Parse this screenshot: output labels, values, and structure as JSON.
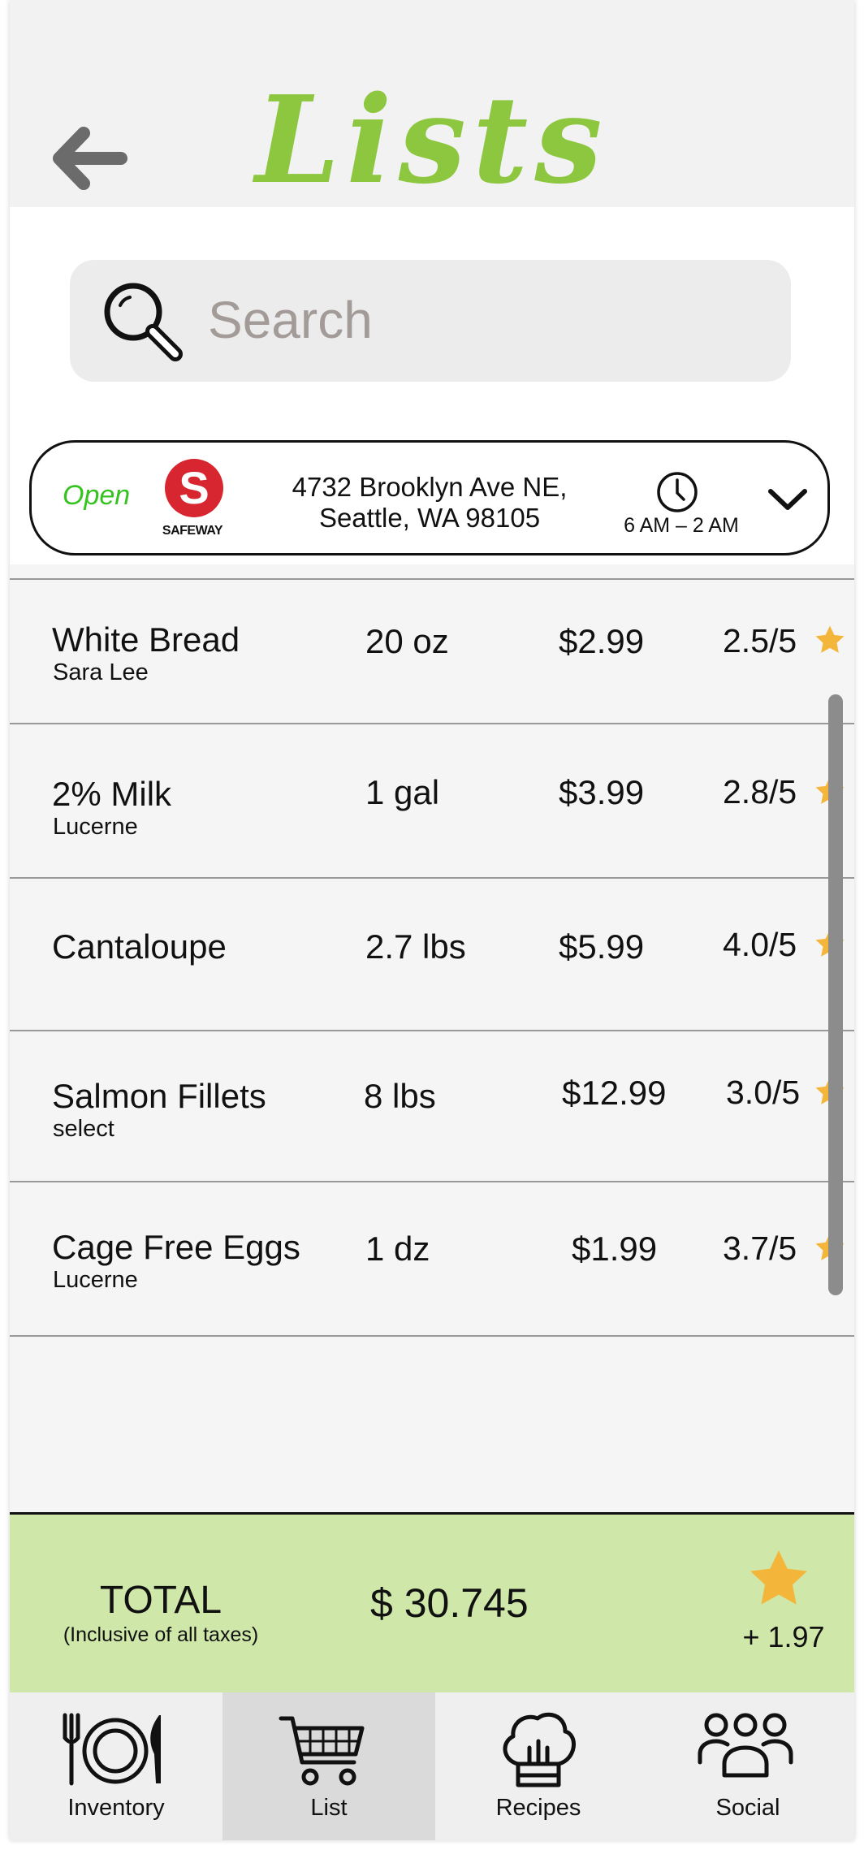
{
  "header": {
    "title": "Lists",
    "back_icon": "arrow-left-icon",
    "accent_color": "#8dc63f"
  },
  "search": {
    "placeholder": "Search",
    "value": "",
    "icon": "search-icon"
  },
  "store": {
    "status": "Open",
    "status_color": "#35c41f",
    "logo_letter": "S",
    "logo_text": "SAFEWAY",
    "logo_color": "#d7262f",
    "address_line1": "4732 Brooklyn Ave NE,",
    "address_line2": "Seattle, WA 98105",
    "hours": "6 AM – 2 AM",
    "clock_icon": "clock-icon",
    "dropdown_icon": "chevron-down-icon"
  },
  "list": {
    "items": [
      {
        "name": "White Bread",
        "brand": "Sara Lee",
        "qty": "20 oz",
        "price": "$2.99",
        "rating": "2.5/5"
      },
      {
        "name": "2% Milk",
        "brand": "Lucerne",
        "qty": "1 gal",
        "price": "$3.99",
        "rating": "2.8/5"
      },
      {
        "name": "Cantaloupe",
        "brand": "",
        "qty": "2.7 lbs",
        "price": "$5.99",
        "rating": "4.0/5"
      },
      {
        "name": "Salmon Fillets",
        "brand": "select",
        "qty": "8 lbs",
        "price": "$12.99",
        "rating": "3.0/5"
      },
      {
        "name": "Cage Free Eggs",
        "brand": "Lucerne",
        "qty": "1 dz",
        "price": "$1.99",
        "rating": "3.7/5"
      }
    ],
    "star_color": "#f4b63a"
  },
  "total": {
    "label": "TOTAL",
    "note": "(Inclusive of all taxes)",
    "amount": "$ 30.745",
    "points": "+ 1.97",
    "bar_color": "#cfe8a9"
  },
  "nav": {
    "items": [
      {
        "label": "Inventory",
        "icon": "plate-cutlery-icon",
        "active": false
      },
      {
        "label": "List",
        "icon": "shopping-cart-icon",
        "active": true
      },
      {
        "label": "Recipes",
        "icon": "chef-hat-icon",
        "active": false
      },
      {
        "label": "Social",
        "icon": "people-icon",
        "active": false
      }
    ]
  }
}
